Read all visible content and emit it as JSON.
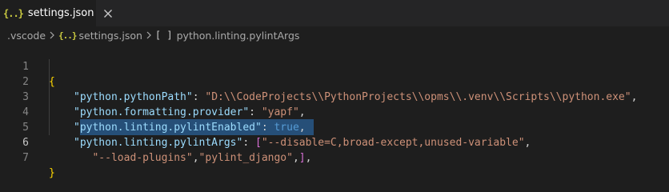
{
  "tab": {
    "icon": "{..}",
    "label": "settings.json"
  },
  "breadcrumb": {
    "folder": ".vscode",
    "file_icon": "{..}",
    "file": "settings.json",
    "symbol_icon": "[ ]",
    "symbol": "python.linting.pylintArgs"
  },
  "icons": {
    "tab_file": "json-file-icon",
    "tab_close": "close-icon",
    "breadcrumb_separator": "chevron-right-icon",
    "breadcrumb_array": "array-symbol-icon"
  },
  "colors": {
    "key": "#9cdcfe",
    "string": "#ce9178",
    "boolean": "#569cd6",
    "selection": "#264f78"
  },
  "editor": {
    "line_numbers": [
      "1",
      "2",
      "3",
      "4",
      "5",
      "6",
      "7"
    ],
    "active_line": "6",
    "lines": {
      "l1": {
        "open": "{"
      },
      "l2": {
        "key": "\"python.pythonPath\"",
        "colon": ": ",
        "value": "\"D:\\\\CodeProjects\\\\PythonProjects\\\\opms\\\\.venv\\\\Scripts\\\\python.exe\"",
        "end": ","
      },
      "l3": {
        "key": "\"python.formatting.provider\"",
        "colon": ": ",
        "value": "\"yapf\"",
        "end": ","
      },
      "l4": {
        "key": "\"python.linting.pylintEnabled\"",
        "colon": ": ",
        "value": "true",
        "end": ","
      },
      "l5": {
        "key": "\"python.linting.pylintArgs\"",
        "colon": ": ",
        "bracket": "[",
        "value": "\"--disable=C,broad-except,unused-variable\"",
        "end": ","
      },
      "l6": {
        "value1": "\"--load-plugins\"",
        "comma": ",",
        "value2": "\"pylint_django\"",
        "comma2": ",",
        "bracket": "]",
        "end": ","
      },
      "l7": {
        "close": "}"
      }
    }
  }
}
